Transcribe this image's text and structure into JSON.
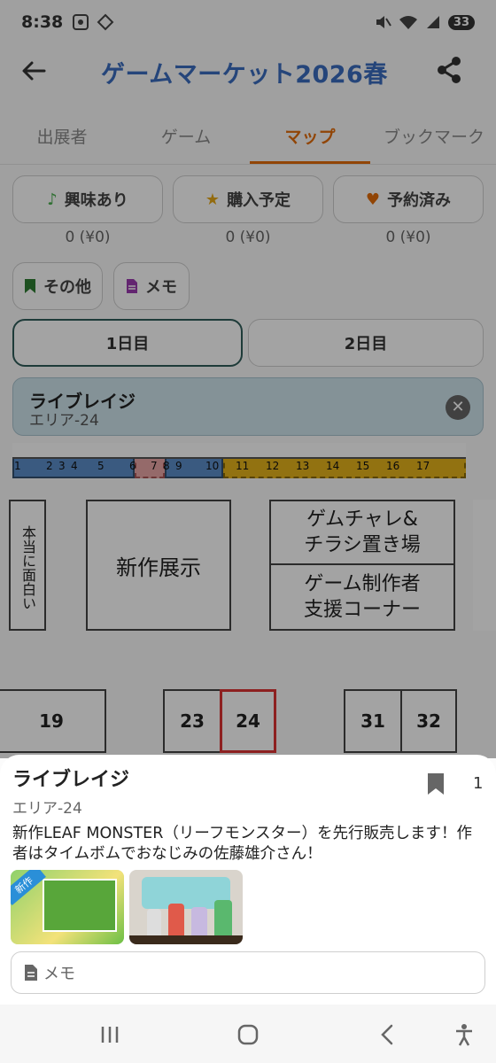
{
  "status": {
    "time": "8:38",
    "battery": "33"
  },
  "app": {
    "title": "ゲームマーケット2026春"
  },
  "tabs": [
    "出展者",
    "ゲーム",
    "マップ",
    "ブックマーク"
  ],
  "filters": {
    "interest": {
      "label": "興味あり",
      "count": "0 (¥0)"
    },
    "planned": {
      "label": "購入予定",
      "count": "0 (¥0)"
    },
    "reserved": {
      "label": "予約済み",
      "count": "0 (¥0)"
    },
    "other": {
      "label": "その他"
    },
    "memo": {
      "label": "メモ"
    }
  },
  "days": [
    "1日目",
    "2日目"
  ],
  "selected": {
    "name": "ライブレイジ",
    "area": "エリア-24"
  },
  "map": {
    "strip_numbers": [
      "1",
      "2",
      "3",
      "4",
      "5",
      "6",
      "7",
      "8",
      "9",
      "10",
      "11",
      "12",
      "13",
      "14",
      "15",
      "16",
      "17"
    ],
    "blocks": {
      "left_text": "本当に面白い",
      "new_release": "新作展示",
      "game_challenge": "ゲムチャレ&\nチラシ置き場",
      "dev_support": "ゲーム制作者\n支援コーナー"
    },
    "booths": [
      "19",
      "23",
      "24",
      "31",
      "32"
    ]
  },
  "sheet": {
    "name": "ライブレイジ",
    "area": "エリア-24",
    "bookmark_count": "1",
    "description": "新作LEAF MONSTER（リーフモンスター）を先行販売します！作者はタイムボムでおなじみの佐藤雄介さん！",
    "thumb1_badge": "新作",
    "memo_placeholder": "メモ"
  },
  "colors": {
    "accent": "#e36c0a",
    "title": "#3a6dbf",
    "strip_blue": "#5b8ec9",
    "strip_pink": "#e9a7a7",
    "strip_gold": "#e4b21c"
  }
}
